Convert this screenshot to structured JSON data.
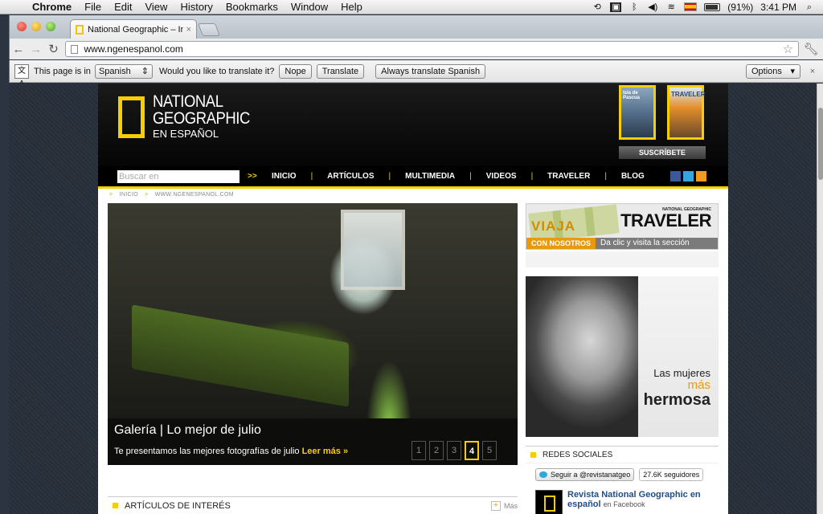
{
  "menubar": {
    "app_name": "Chrome",
    "menus": [
      "File",
      "Edit",
      "View",
      "History",
      "Bookmarks",
      "Window",
      "Help"
    ],
    "battery_text": "(91%)",
    "clock": "3:41 PM"
  },
  "browser": {
    "tab_title": "National Geographic – Inspir",
    "tab_close": "×",
    "url": "www.ngenespanol.com"
  },
  "translate_bar": {
    "prefix": "This page is in",
    "language": "Spanish",
    "question": "Would you like to translate it?",
    "nope": "Nope",
    "translate": "Translate",
    "always": "Always translate Spanish",
    "options": "Options"
  },
  "site": {
    "logo_line1": "NATIONAL",
    "logo_line2": "GEOGRAPHIC",
    "logo_line3": "EN ESPAÑOL",
    "mag1_label": "Isla de Pascua",
    "mag2_label": "TRAVELER",
    "subscribe": "SUSCRÍBETE",
    "search_placeholder": "Buscar en",
    "search_go": ">>",
    "nav": [
      "INICIO",
      "ARTÍCULOS",
      "MULTIMEDIA",
      "VIDEOS",
      "TRAVELER",
      "BLOG"
    ],
    "breadcrumb_home": "INICIO",
    "breadcrumb_current": "WWW.NGENESPANOL.COM",
    "breadcrumb_sep": ">"
  },
  "hero": {
    "title": "Galería | Lo mejor de julio",
    "text": "Te presentamos las mejores fotografías de julio",
    "more": "Leer más »",
    "pages": [
      "1",
      "2",
      "3",
      "4",
      "5"
    ],
    "active_page": "4"
  },
  "articles": {
    "heading": "ARTÍCULOS DE INTERÉS",
    "more": "Más"
  },
  "traveler_ad": {
    "viaja": "VIAJA",
    "brand_small": "NATIONAL GEOGRAPHIC",
    "brand_big": "TRAVELER",
    "con_nosotros": "CON NOSOTROS",
    "clic": "Da clic y visita la sección"
  },
  "model_ad": {
    "line1": "Las mujeres",
    "line2": "más",
    "line3": "hermosa"
  },
  "social": {
    "heading": "REDES SOCIALES",
    "twitter_button": "Seguir a @revistanatgeo",
    "twitter_count": "27.6K seguidores",
    "facebook_name": "Revista National Geographic en español",
    "facebook_on": "en Facebook"
  },
  "colors": {
    "natgeo_yellow": "#f6cf00",
    "header_black": "#050505",
    "traveler_orange": "#e89a0e"
  }
}
